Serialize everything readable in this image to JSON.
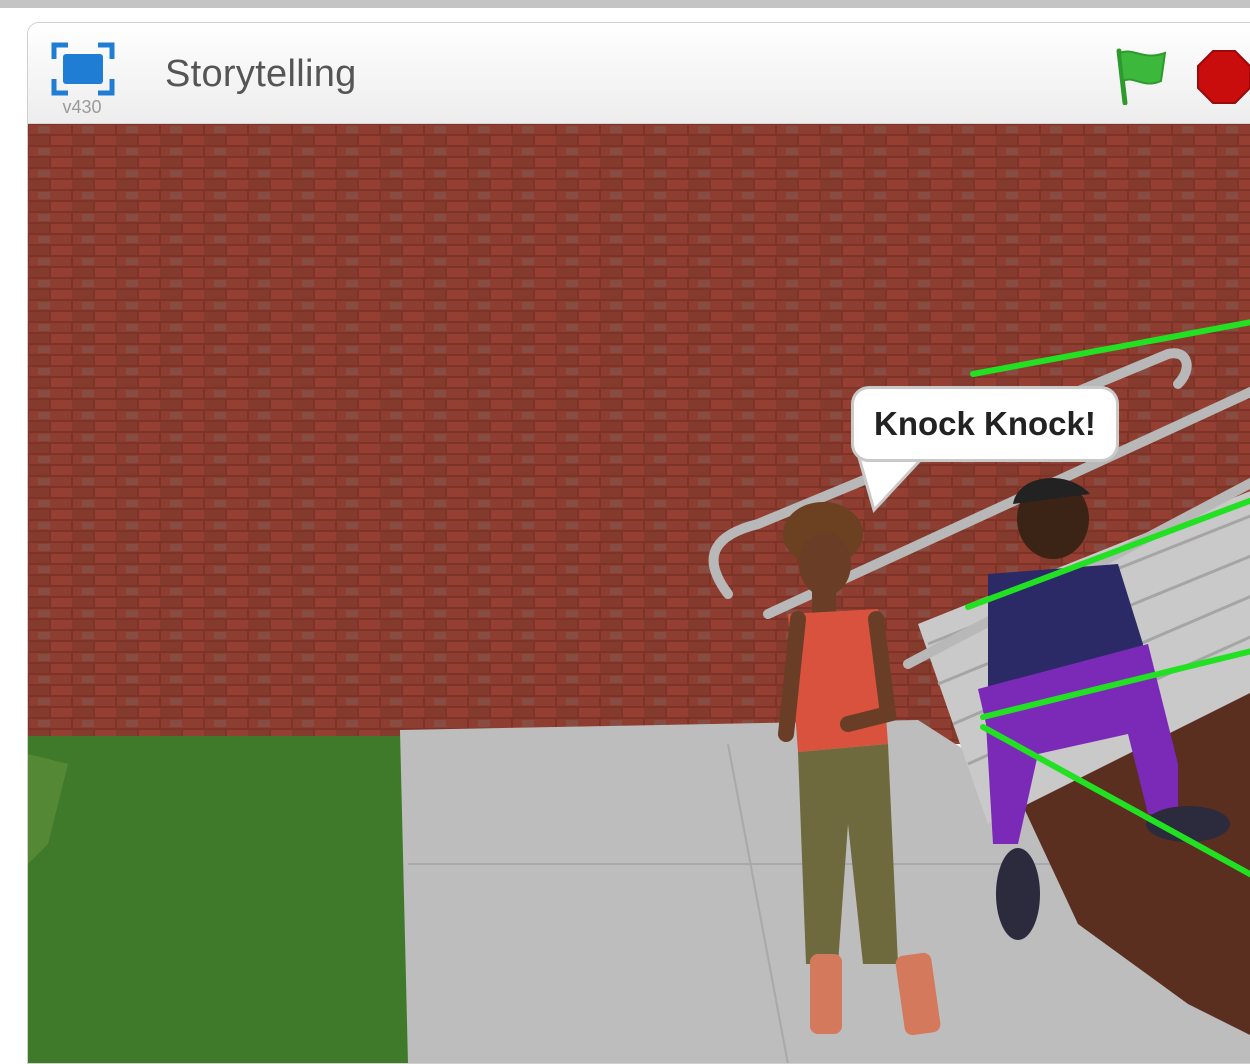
{
  "project": {
    "title": "Storytelling",
    "version": "v430"
  },
  "controls": {
    "green_flag_icon": "green-flag-icon",
    "stop_icon": "stop-sign-icon",
    "fullscreen_icon": "fullscreen-icon"
  },
  "speech": {
    "text": "Knock Knock!"
  },
  "colors": {
    "flag": "#3cb93c",
    "stop": "#c90d0d",
    "fullscreen": "#1f7ed4",
    "annotation_lines": "#22e022",
    "brick": "#8a3b2e",
    "grass": "#3f7a2a",
    "concrete": "#bdbdbd"
  }
}
